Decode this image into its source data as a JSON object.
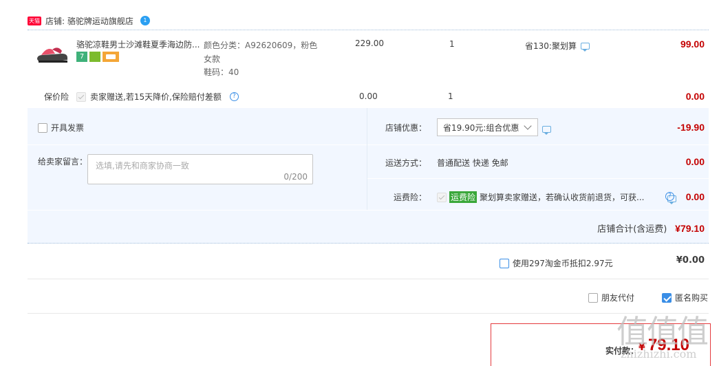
{
  "store": {
    "badge": "天猫",
    "label": "店铺: 骆驼牌运动旗舰店",
    "ww_icon": "1"
  },
  "item": {
    "title": "骆驼凉鞋男士沙滩鞋夏季海边防...",
    "badges": [
      "7",
      "",
      ""
    ],
    "sku_color": "颜色分类：A92620609，粉色 女款",
    "sku_size": "鞋码：40",
    "price": "229.00",
    "qty": "1",
    "discount": "省130:聚划算",
    "total": "99.00"
  },
  "insurance": {
    "label": "保价险",
    "desc": "卖家赠送,若15天降价,保险赔付差额",
    "price": "0.00",
    "qty": "1",
    "total": "0.00"
  },
  "invoice": {
    "label": "开具发票"
  },
  "message": {
    "label": "给卖家留言：",
    "placeholder": "选填,请先和商家协商一致",
    "counter": "0/200"
  },
  "store_discount": {
    "label": "店铺优惠：",
    "value": "省19.90元:组合优惠",
    "amount": "-19.90"
  },
  "shipping": {
    "label": "运送方式：",
    "value": "普通配送 快递 免邮",
    "amount": "0.00"
  },
  "freight_insurance": {
    "label": "运费险：",
    "tag": "运费险",
    "desc": "聚划算卖家赠送，若确认收货前退货，可获...",
    "amount": "0.00"
  },
  "store_total": {
    "label": "店铺合计(含运费)",
    "amount": "¥79.10"
  },
  "taojinbi": {
    "label": "使用297淘金币抵扣2.97元",
    "amount": "¥0.00"
  },
  "options": {
    "friend_pay": "朋友代付",
    "anonymous": "匿名购买"
  },
  "pay": {
    "label": "实付款：",
    "currency": "¥",
    "amount": "79.10"
  },
  "watermark": {
    "text": "值值值",
    "url": "zhizhizhi.com"
  },
  "colors": {
    "accent_red": "#c40000",
    "highlight_bg": "#f2f7ff",
    "checkbox_blue": "#3a8ee6",
    "tag_green": "#39a739"
  }
}
